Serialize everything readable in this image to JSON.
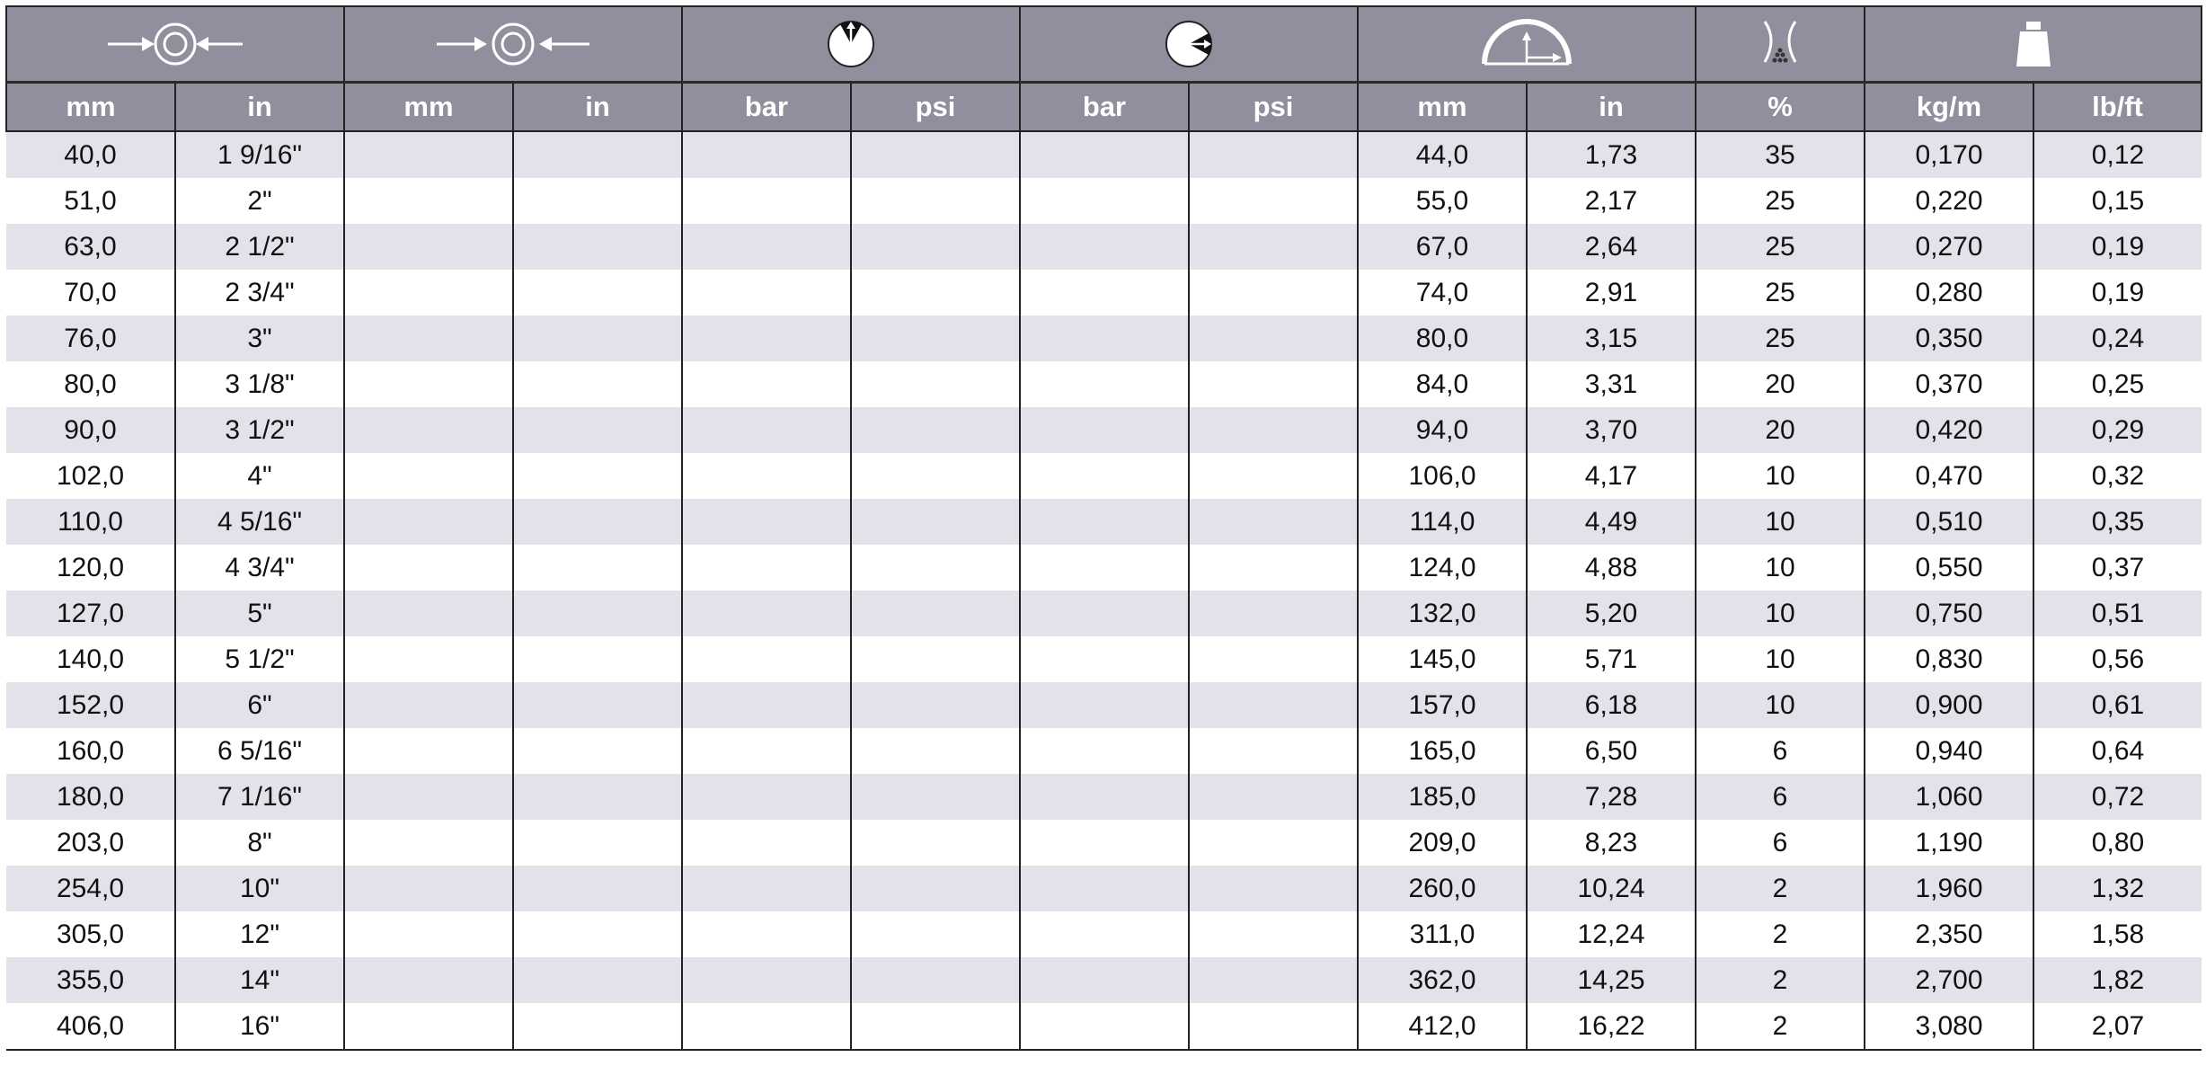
{
  "icons": [
    {
      "name": "outer-diameter-compress-icon"
    },
    {
      "name": "inner-diameter-press-icon"
    },
    {
      "name": "working-pressure-gauge-icon"
    },
    {
      "name": "burst-pressure-gauge-icon"
    },
    {
      "name": "bend-radius-arc-icon"
    },
    {
      "name": "vacuum-hose-pinch-icon"
    },
    {
      "name": "weight-icon"
    }
  ],
  "units": [
    "mm",
    "in",
    "mm",
    "in",
    "bar",
    "psi",
    "bar",
    "psi",
    "mm",
    "in",
    "%",
    "kg/m",
    "lb/ft"
  ],
  "rows": [
    [
      "40,0",
      "1 9/16\"",
      "",
      "",
      "",
      "",
      "",
      "",
      "44,0",
      "1,73",
      "35",
      "0,170",
      "0,12"
    ],
    [
      "51,0",
      "2\"",
      "",
      "",
      "",
      "",
      "",
      "",
      "55,0",
      "2,17",
      "25",
      "0,220",
      "0,15"
    ],
    [
      "63,0",
      "2 1/2\"",
      "",
      "",
      "",
      "",
      "",
      "",
      "67,0",
      "2,64",
      "25",
      "0,270",
      "0,19"
    ],
    [
      "70,0",
      "2 3/4\"",
      "",
      "",
      "",
      "",
      "",
      "",
      "74,0",
      "2,91",
      "25",
      "0,280",
      "0,19"
    ],
    [
      "76,0",
      "3\"",
      "",
      "",
      "",
      "",
      "",
      "",
      "80,0",
      "3,15",
      "25",
      "0,350",
      "0,24"
    ],
    [
      "80,0",
      "3 1/8\"",
      "",
      "",
      "",
      "",
      "",
      "",
      "84,0",
      "3,31",
      "20",
      "0,370",
      "0,25"
    ],
    [
      "90,0",
      "3 1/2\"",
      "",
      "",
      "",
      "",
      "",
      "",
      "94,0",
      "3,70",
      "20",
      "0,420",
      "0,29"
    ],
    [
      "102,0",
      "4\"",
      "",
      "",
      "",
      "",
      "",
      "",
      "106,0",
      "4,17",
      "10",
      "0,470",
      "0,32"
    ],
    [
      "110,0",
      "4 5/16\"",
      "",
      "",
      "",
      "",
      "",
      "",
      "114,0",
      "4,49",
      "10",
      "0,510",
      "0,35"
    ],
    [
      "120,0",
      "4 3/4\"",
      "",
      "",
      "",
      "",
      "",
      "",
      "124,0",
      "4,88",
      "10",
      "0,550",
      "0,37"
    ],
    [
      "127,0",
      "5\"",
      "",
      "",
      "",
      "",
      "",
      "",
      "132,0",
      "5,20",
      "10",
      "0,750",
      "0,51"
    ],
    [
      "140,0",
      "5 1/2\"",
      "",
      "",
      "",
      "",
      "",
      "",
      "145,0",
      "5,71",
      "10",
      "0,830",
      "0,56"
    ],
    [
      "152,0",
      "6\"",
      "",
      "",
      "",
      "",
      "",
      "",
      "157,0",
      "6,18",
      "10",
      "0,900",
      "0,61"
    ],
    [
      "160,0",
      "6 5/16\"",
      "",
      "",
      "",
      "",
      "",
      "",
      "165,0",
      "6,50",
      "6",
      "0,940",
      "0,64"
    ],
    [
      "180,0",
      "7 1/16\"",
      "",
      "",
      "",
      "",
      "",
      "",
      "185,0",
      "7,28",
      "6",
      "1,060",
      "0,72"
    ],
    [
      "203,0",
      "8\"",
      "",
      "",
      "",
      "",
      "",
      "",
      "209,0",
      "8,23",
      "6",
      "1,190",
      "0,80"
    ],
    [
      "254,0",
      "10\"",
      "",
      "",
      "",
      "",
      "",
      "",
      "260,0",
      "10,24",
      "2",
      "1,960",
      "1,32"
    ],
    [
      "305,0",
      "12\"",
      "",
      "",
      "",
      "",
      "",
      "",
      "311,0",
      "12,24",
      "2",
      "2,350",
      "1,58"
    ],
    [
      "355,0",
      "14\"",
      "",
      "",
      "",
      "",
      "",
      "",
      "362,0",
      "14,25",
      "2",
      "2,700",
      "1,82"
    ],
    [
      "406,0",
      "16\"",
      "",
      "",
      "",
      "",
      "",
      "",
      "412,0",
      "16,22",
      "2",
      "3,080",
      "2,07"
    ]
  ],
  "colors": {
    "header_bg": "#8f8f9e",
    "row_alt": "#e2e2ea",
    "row_plain": "#ffffff",
    "rule": "#222222"
  }
}
